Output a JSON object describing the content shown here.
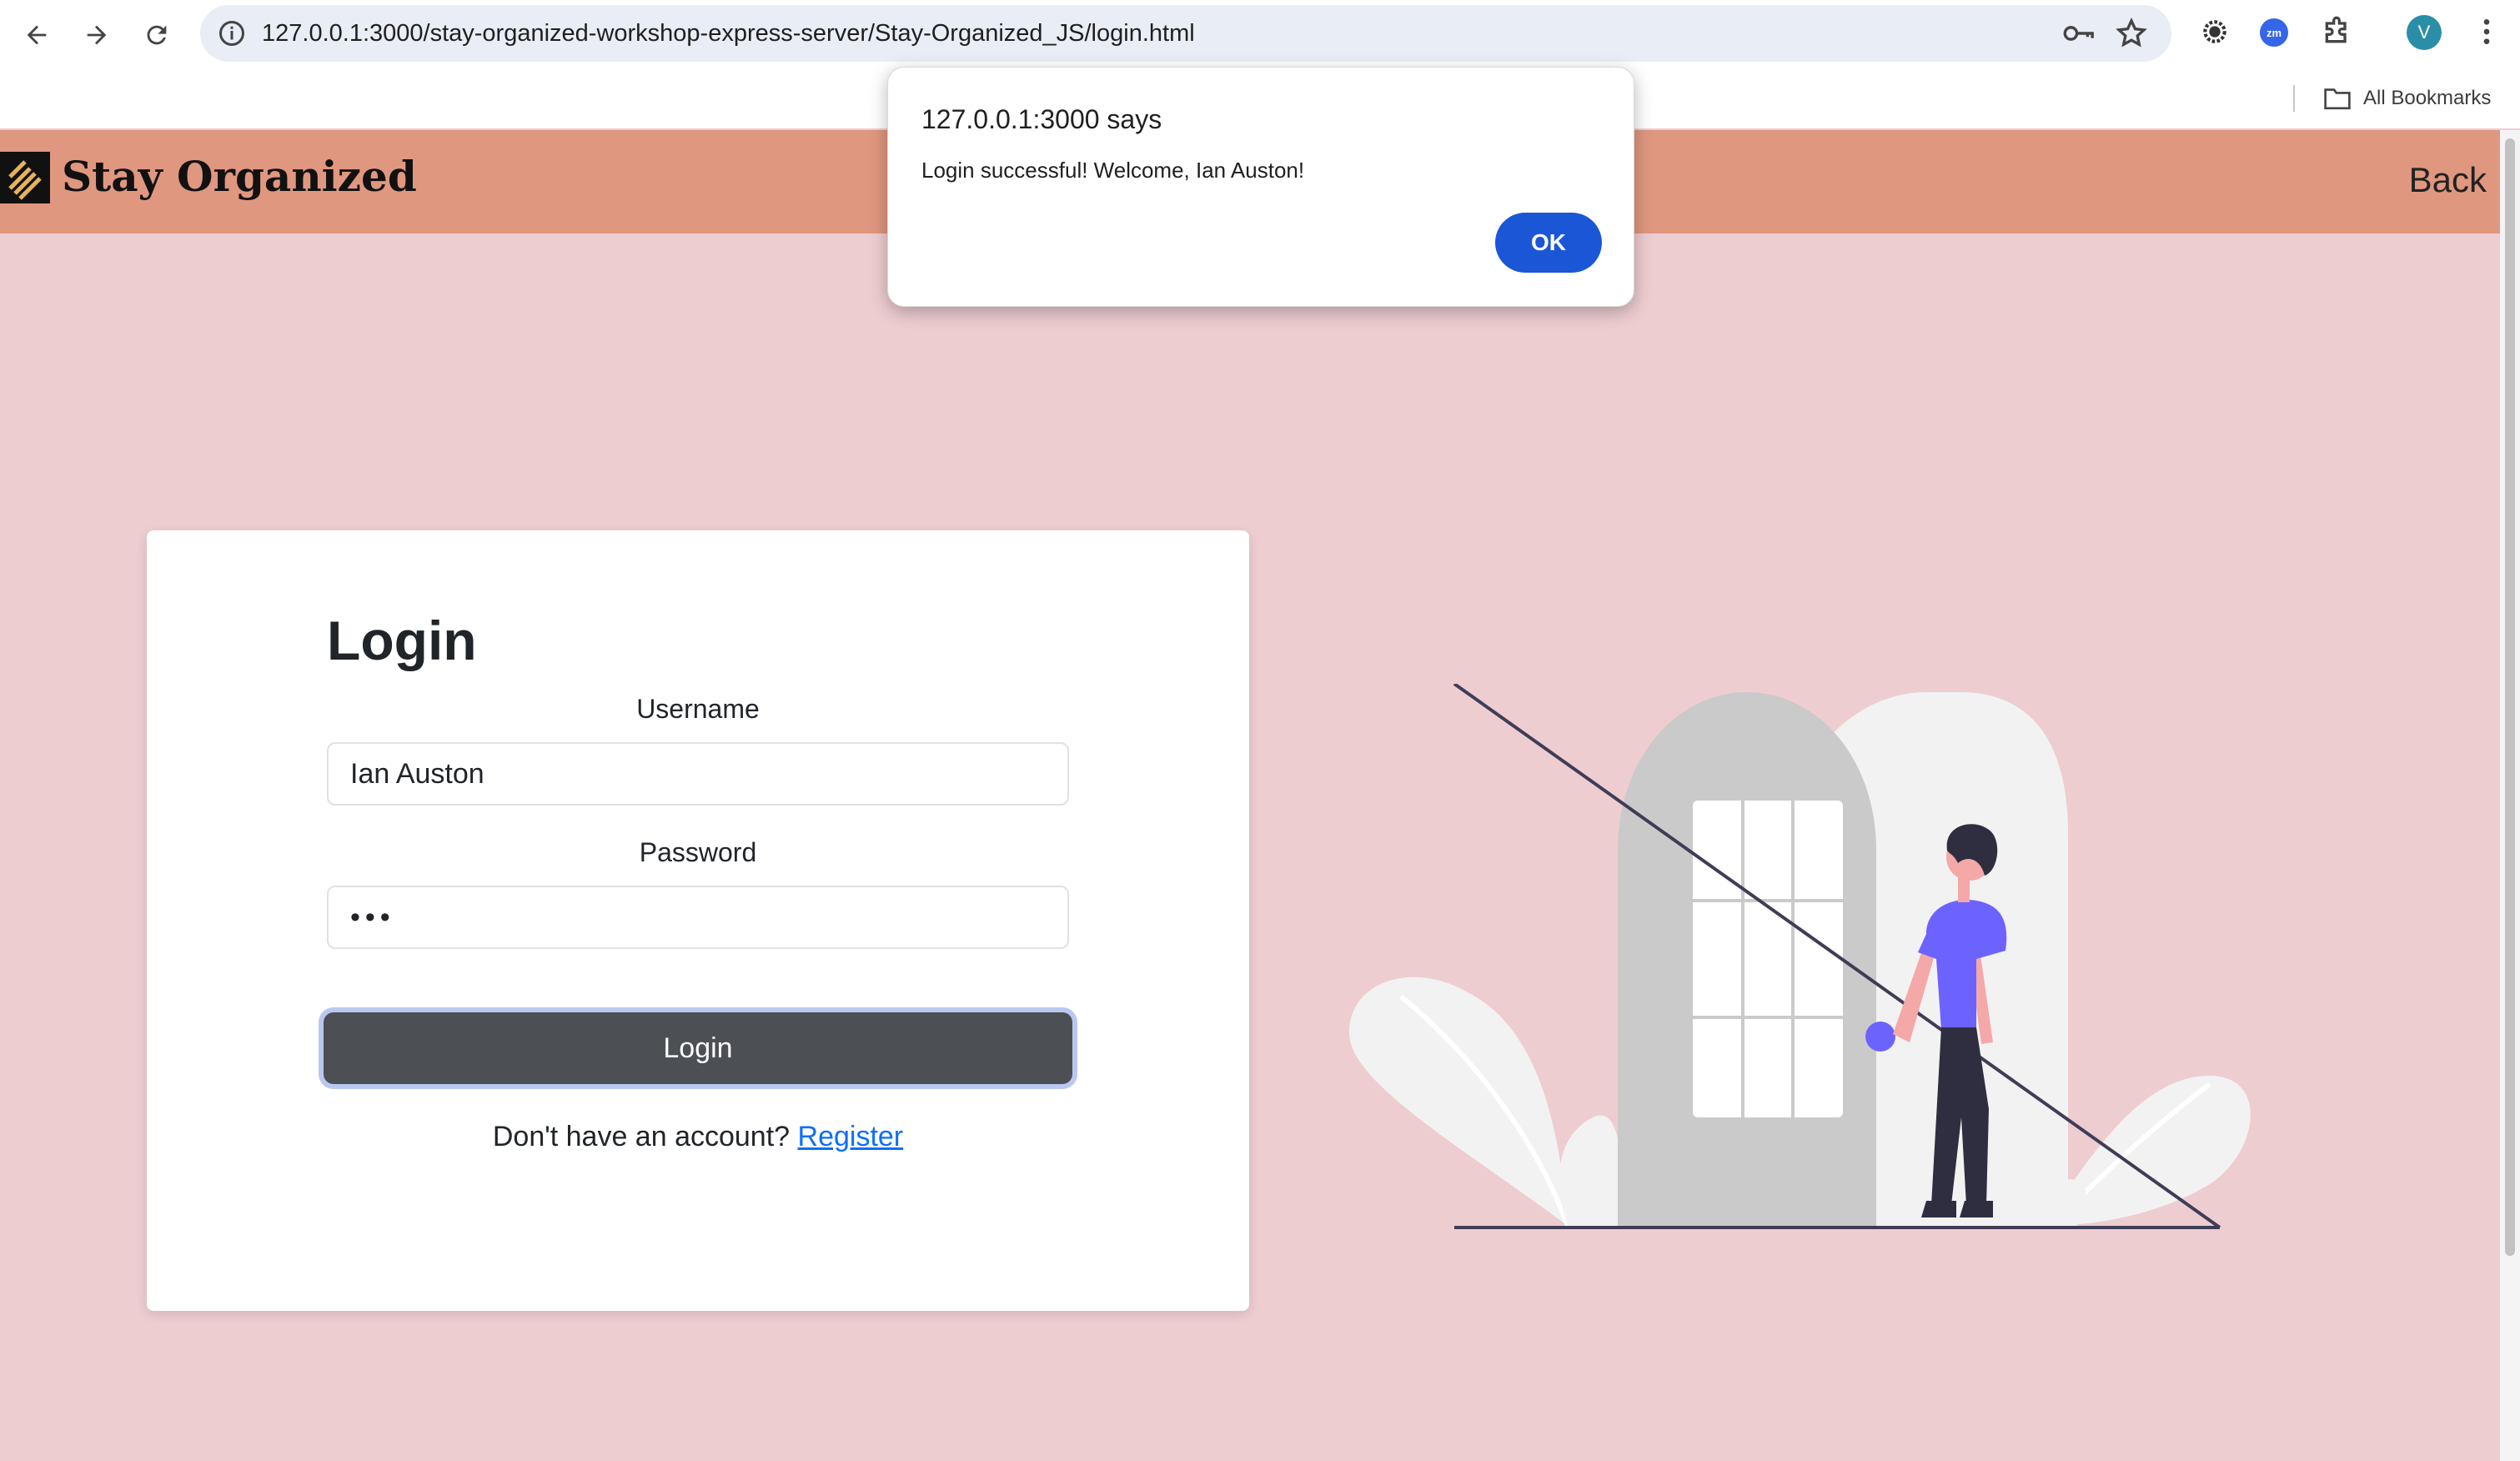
{
  "browser": {
    "url": "127.0.0.1:3000/stay-organized-workshop-express-server/Stay-Organized_JS/login.html",
    "profile_initial": "V",
    "zoom_ext_label": "zm",
    "bookmarks_label": "All Bookmarks",
    "icons": [
      "back-arrow-icon",
      "forward-arrow-icon",
      "reload-icon",
      "site-info-icon",
      "password-key-icon",
      "bookmark-star-icon",
      "extension-gear-icon",
      "zoom-extension-icon",
      "puzzle-icon",
      "menu-dots-icon",
      "folder-icon"
    ]
  },
  "header": {
    "brand": "Stay Organized",
    "back_label": "Back",
    "background_color": "#e0977f"
  },
  "login": {
    "title": "Login",
    "username_label": "Username",
    "username_value": "Ian Auston",
    "password_label": "Password",
    "password_value": "•••",
    "button_label": "Login",
    "signup_prompt": "Don't have an account?",
    "register_link": "Register"
  },
  "dialog": {
    "title": "127.0.0.1:3000 says",
    "message": "Login successful! Welcome, Ian Auston!",
    "ok_label": "OK"
  },
  "colors": {
    "page_background": "#eecdd1",
    "accent_blue": "#1a56d6",
    "button_dark": "#4c4f53",
    "figure_shirt": "#6c63ff"
  }
}
